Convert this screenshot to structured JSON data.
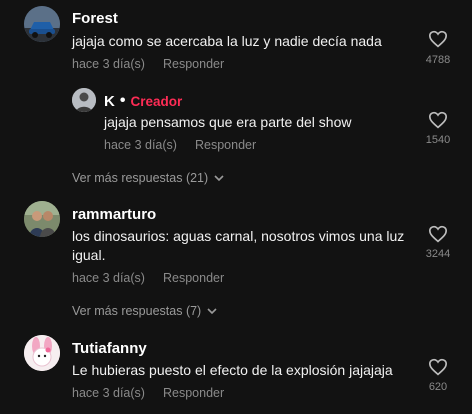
{
  "colors": {
    "background": "#121212",
    "creator_badge": "#fe2c55",
    "muted_text": "#8a8a8a"
  },
  "comments": [
    {
      "author": "Forest",
      "text": "jajaja como se acercaba la luz y nadie decía nada",
      "time": "hace 3 día(s)",
      "reply_label": "Responder",
      "likes": "4788",
      "icon": "heart-outline-icon",
      "reply": {
        "author": "K",
        "separator": "•",
        "badge": "Creador",
        "text": "jajaja pensamos que era parte del show",
        "time": "hace 3 día(s)",
        "reply_label": "Responder",
        "likes": "1540"
      },
      "more_replies": "Ver más respuestas (21)"
    },
    {
      "author": "rammarturo",
      "text_line1": "los dinosaurios: aguas carnal, nosotros vimos una luz",
      "text_line2": "igual.",
      "time": "hace 3 día(s)",
      "reply_label": "Responder",
      "likes": "3244",
      "more_replies": "Ver más respuestas (7)"
    },
    {
      "author": "Tutiafanny",
      "text": "Le hubieras puesto el efecto de la explosión jajajaja",
      "time": "hace 3 día(s)",
      "reply_label": "Responder",
      "likes": "620"
    }
  ]
}
